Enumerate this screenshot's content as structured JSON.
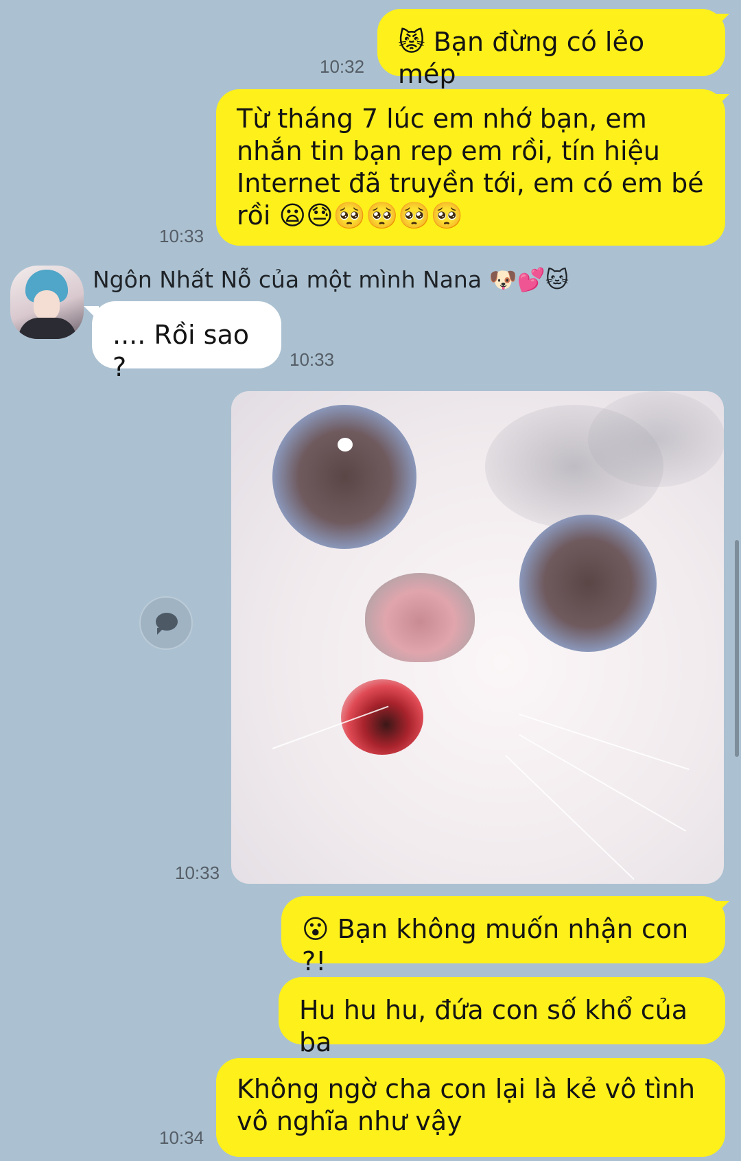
{
  "messages": [
    {
      "id": "m1",
      "from": "me",
      "text": "😾 Bạn đừng có lẻo mép",
      "time": "10:32"
    },
    {
      "id": "m2",
      "from": "me",
      "text": "Từ tháng 7 lúc em nhớ bạn, em nhắn tin bạn rep em rồi, tín hiệu Internet đã truyền tới, em có em bé rồi 😦😓🥺🥺🥺🥺",
      "time": "10:33"
    },
    {
      "id": "m3",
      "from": "other",
      "sender": "Ngôn Nhất Nỗ của một mình Nana 🐶💕🐱",
      "text": ".... Rồi sao ?",
      "time": "10:33"
    },
    {
      "id": "m4",
      "from": "me",
      "type": "image",
      "image": "white-cat-surprised-photo",
      "time": "10:33"
    },
    {
      "id": "m5",
      "from": "me",
      "text": "😮 Bạn không muốn nhận con ?!",
      "time": ""
    },
    {
      "id": "m6",
      "from": "me",
      "text": "Hu hu hu, đứa con số khổ của ba",
      "time": ""
    },
    {
      "id": "m7",
      "from": "me",
      "text": "Không ngờ cha con lại là kẻ vô tình vô nghĩa như vậy",
      "time": "10:34"
    }
  ],
  "icons": {
    "share": "chat-bubble-icon",
    "avatar": "contact-avatar"
  },
  "colors": {
    "background": "#abc1d1",
    "my_bubble": "#fef01b",
    "their_bubble": "#ffffff"
  }
}
